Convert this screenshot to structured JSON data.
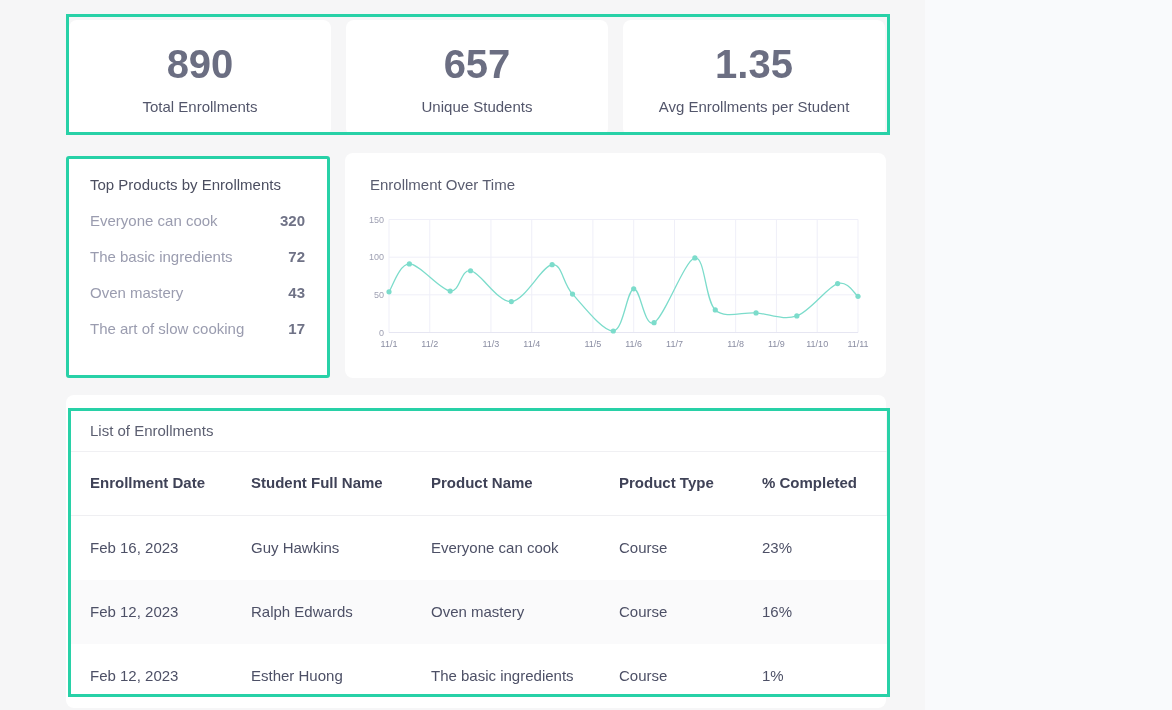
{
  "stats": [
    {
      "value": "890",
      "label": "Total Enrollments"
    },
    {
      "value": "657",
      "label": "Unique Students"
    },
    {
      "value": "1.35",
      "label": "Avg Enrollments per Student"
    }
  ],
  "top_products": {
    "title": "Top Products by Enrollments",
    "items": [
      {
        "name": "Everyone can cook",
        "count": "320"
      },
      {
        "name": "The basic ingredients",
        "count": "72"
      },
      {
        "name": "Oven mastery",
        "count": "43"
      },
      {
        "name": "The art of slow cooking",
        "count": "17"
      }
    ]
  },
  "enrollment_chart": {
    "title": "Enrollment Over Time",
    "chart_data": {
      "type": "line",
      "grid": true,
      "categories": [
        "11/1",
        null,
        "11/2",
        null,
        null,
        "11/3",
        null,
        "11/4",
        null,
        null,
        "11/5",
        null,
        "11/6",
        null,
        "11/7",
        null,
        null,
        "11/8",
        null,
        "11/9",
        null,
        "11/10",
        null,
        "11/11"
      ],
      "series": [
        {
          "color": "#7cdccb",
          "values": [
            54,
            91,
            null,
            55,
            82,
            null,
            41,
            null,
            90,
            51,
            null,
            2,
            58,
            13,
            null,
            99,
            30,
            null,
            26,
            null,
            22,
            null,
            65,
            48
          ]
        }
      ],
      "ylim": [
        0,
        150
      ],
      "yticks": [
        0,
        50,
        100,
        150
      ]
    }
  },
  "enrollments_table": {
    "title": "List of Enrollments",
    "columns": [
      "Enrollment Date",
      "Student Full Name",
      "Product Name",
      "Product Type",
      "% Completed"
    ],
    "rows": [
      {
        "cells": [
          "Feb 16, 2023",
          "Guy Hawkins",
          "Everyone can cook",
          "Course",
          "23%"
        ]
      },
      {
        "cells": [
          "Feb 12, 2023",
          "Ralph Edwards",
          "Oven mastery",
          "Course",
          "16%"
        ]
      },
      {
        "cells": [
          "Feb 12, 2023",
          "Esther Huong",
          "The basic ingredients",
          "Course",
          "1%"
        ]
      }
    ]
  }
}
